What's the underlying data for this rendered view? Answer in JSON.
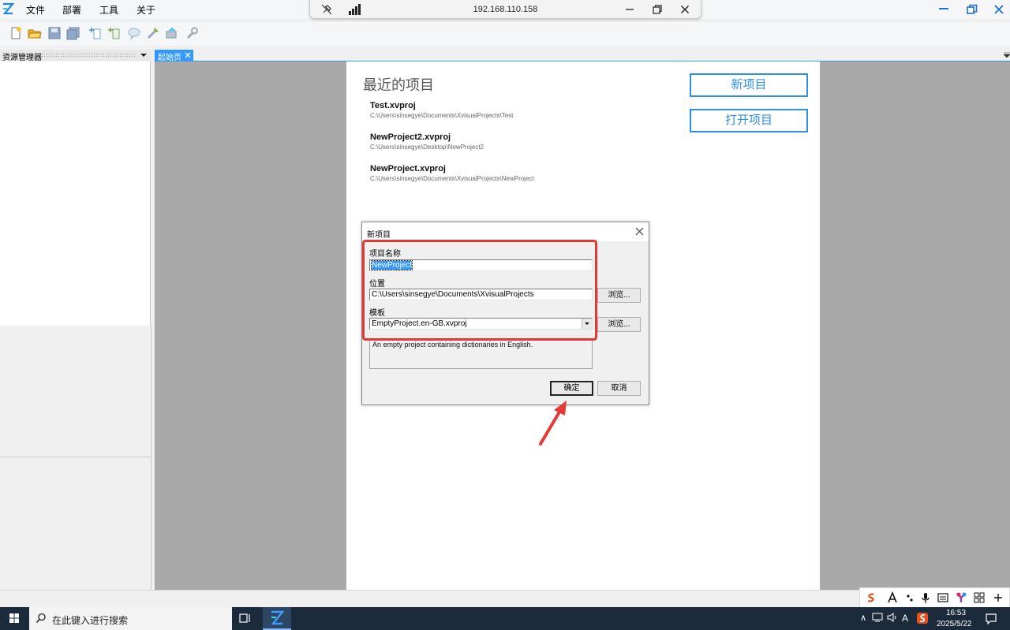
{
  "menu": {
    "items": [
      "文件",
      "部署",
      "工具",
      "关于"
    ]
  },
  "remote_bar": {
    "host": "192.168.110.158"
  },
  "toolbar": {
    "icons": [
      "new-file-icon",
      "open-folder-icon",
      "save-icon",
      "save-all-icon",
      "add-item-icon",
      "add-folder-icon",
      "comment-icon",
      "build-icon",
      "deploy-icon",
      "wrench-icon"
    ]
  },
  "resource_panel": {
    "title": "资源管理器"
  },
  "tabs": [
    {
      "label": "起始页"
    }
  ],
  "start_page": {
    "recent_title": "最近的项目",
    "recent": [
      {
        "name": "Test.xvproj",
        "path": "C:\\Users\\sinsegye\\Documents\\XvisualProjects\\Test"
      },
      {
        "name": "NewProject2.xvproj",
        "path": "C:\\Users\\sinsegye\\Desktop\\NewProject2"
      },
      {
        "name": "NewProject.xvproj",
        "path": "C:\\Users\\sinsegye\\Documents\\XvisualProjects\\NewProject"
      }
    ],
    "new_project_label": "新项目",
    "open_project_label": "打开项目"
  },
  "dialog": {
    "title": "新项目",
    "name_label": "项目名称",
    "name_value": "NewProject",
    "location_label": "位置",
    "location_value": "C:\\Users\\sinsegye\\Documents\\XvisualProjects",
    "browse_label": "浏览...",
    "template_label": "模板",
    "template_value": "EmptyProject.en-GB.xvproj",
    "description": "An empty project containing dictionaries in English.",
    "ok_label": "确定",
    "cancel_label": "取消"
  },
  "taskbar": {
    "search_placeholder": "在此键入进行搜索",
    "time": "16:53",
    "date": "2025/5/22"
  },
  "colors": {
    "accent": "#3399ff",
    "highlight": "#e53935",
    "taskbar": "#1c2b3c"
  }
}
